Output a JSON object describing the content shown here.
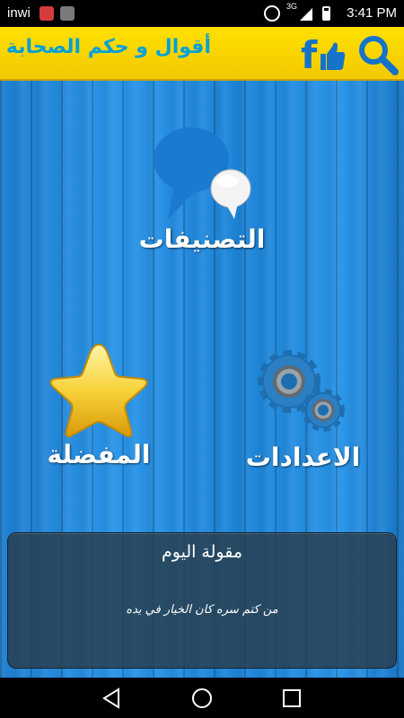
{
  "status_bar": {
    "carrier": "inwi",
    "network": "3G",
    "time": "3:41 PM"
  },
  "app_bar": {
    "title": "أقوال و حكم الصحابة",
    "search_icon": "search-icon",
    "facebook_icon": "facebook-like-icon"
  },
  "menu": {
    "categories_label": "التصنيفات",
    "favorites_label": "المفضلة",
    "settings_label": "الاعدادات"
  },
  "quote": {
    "title": "مقولة اليوم",
    "text": "من كتم سره كان الخيار في يده"
  },
  "nav": {
    "back_icon": "back-triangle-icon",
    "home_icon": "home-circle-icon",
    "recent_icon": "recent-square-icon"
  },
  "colors": {
    "app_bar": "#f4c900",
    "title": "#00a0d6",
    "wood": "#2a95e8",
    "panel": "#283c4b"
  }
}
